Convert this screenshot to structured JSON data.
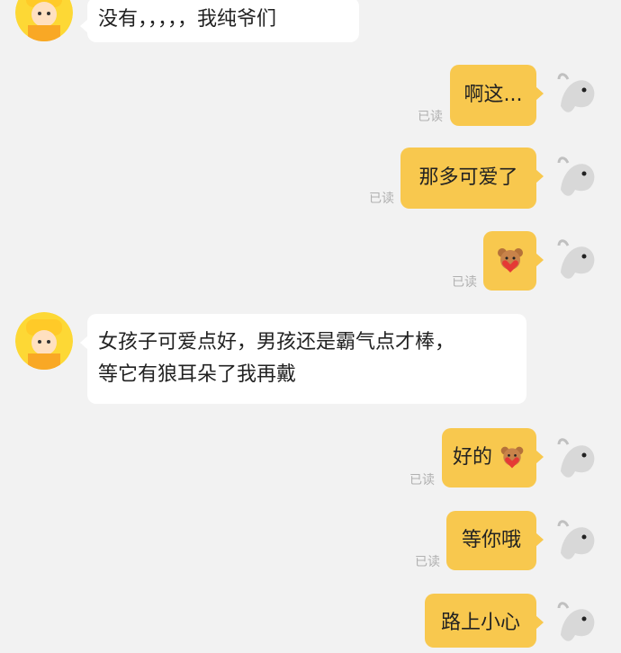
{
  "read_label": "已读",
  "messages": [
    {
      "side": "left",
      "text": "没有，，，，，我纯爷们"
    },
    {
      "side": "right",
      "text": "啊这...",
      "read": "已读"
    },
    {
      "side": "right",
      "text": "那多可爱了",
      "read": "已读"
    },
    {
      "side": "right",
      "text": "",
      "emoji": "bear-heart-icon",
      "read": "已读"
    },
    {
      "side": "left",
      "text_line1": "女孩子可爱点好，男孩还是霸气点才棒，",
      "text_line2": "等它有狼耳朵了我再戴"
    },
    {
      "side": "right",
      "text": "好的",
      "emoji": "bear-heart-icon",
      "read": "已读"
    },
    {
      "side": "right",
      "text": "等你哦",
      "read": "已读"
    },
    {
      "side": "right",
      "text": "路上小心",
      "read": ""
    }
  ],
  "colors": {
    "background": "#f2f2f2",
    "self_bubble": "#f8c84e",
    "other_bubble": "#ffffff",
    "read_text": "#b0b0b0"
  }
}
